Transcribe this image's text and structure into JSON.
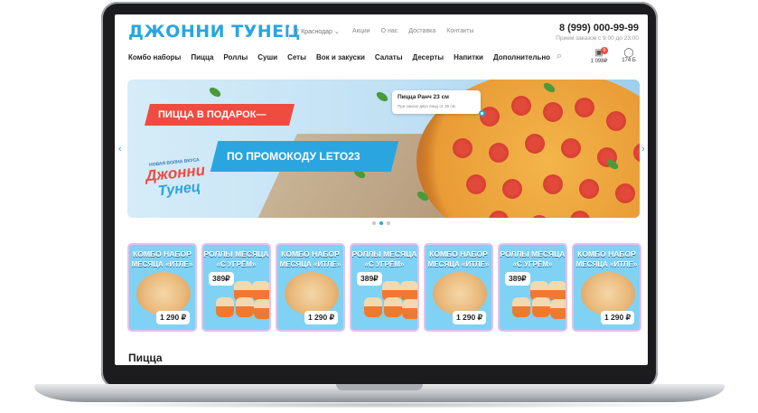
{
  "header": {
    "logo": "ДЖОННИ ТУНЕЦ",
    "city": "Краснодар",
    "top_links": [
      "Акции",
      "О нас",
      "Доставка",
      "Контакты"
    ],
    "phone": "8 (999) 000-99-99",
    "hours": "Прием заказов с 9:00 до 23:00",
    "nav": [
      "Комбо наборы",
      "Пицца",
      "Роллы",
      "Суши",
      "Сеты",
      "Вок и закуски",
      "Салаты",
      "Десерты",
      "Напитки",
      "Дополнительно"
    ],
    "cart_badge": "0",
    "cart_label": "1 098₽",
    "user_label": "174 Б"
  },
  "banner": {
    "ribbon_red": "ПИЦЦА В ПОДАРОК—",
    "ribbon_blue": "ПО ПРОМОКОДУ LETO23",
    "logo_small": "НОВАЯ ВОЛНА ВКУСА",
    "logo_top": "Джонни",
    "logo_bottom": "Тунец",
    "tooltip_title": "Пицца Ранч 23 см",
    "tooltip_sub": "При заказе двух пицц от 35 см",
    "slides": 3,
    "active_slide": 2
  },
  "cards": [
    {
      "kind": "combo",
      "line1": "КОМБО НАБОР",
      "line2": "МЕСЯЦА «ИТЛЕ»",
      "price": "1 290 ₽"
    },
    {
      "kind": "rolls",
      "line1": "РОЛЛЫ МЕСЯЦА",
      "line2": "«С УГРЁМ»",
      "price": "389₽"
    },
    {
      "kind": "combo",
      "line1": "КОМБО НАБОР",
      "line2": "МЕСЯЦА «ИТЛЕ»",
      "price": "1 290 ₽"
    },
    {
      "kind": "rolls",
      "line1": "РОЛЛЫ МЕСЯЦА",
      "line2": "«С УГРЁМ»",
      "price": "389₽"
    },
    {
      "kind": "combo",
      "line1": "КОМБО НАБОР",
      "line2": "МЕСЯЦА «ИТЛЕ»",
      "price": "1 290 ₽"
    },
    {
      "kind": "rolls",
      "line1": "РОЛЛЫ МЕСЯЦА",
      "line2": "«С УГРЁМ»",
      "price": "389₽"
    },
    {
      "kind": "combo",
      "line1": "КОМБО НАБОР",
      "line2": "МЕСЯЦА «ИТЛЕ»",
      "price": "1 290 ₽"
    }
  ],
  "section_title": "Пицца",
  "icons": {
    "location": "location-pin-icon",
    "chevron": "chevron-down-icon",
    "search": "search-icon",
    "cart": "cart-icon",
    "user": "user-icon",
    "prev": "chevron-left-icon",
    "next": "chevron-right-icon"
  },
  "colors": {
    "brand_blue": "#2aa5e0",
    "accent_red": "#ef4b3f",
    "card_bg": "#7fd2f3",
    "card_border": "#e3c1ea"
  }
}
